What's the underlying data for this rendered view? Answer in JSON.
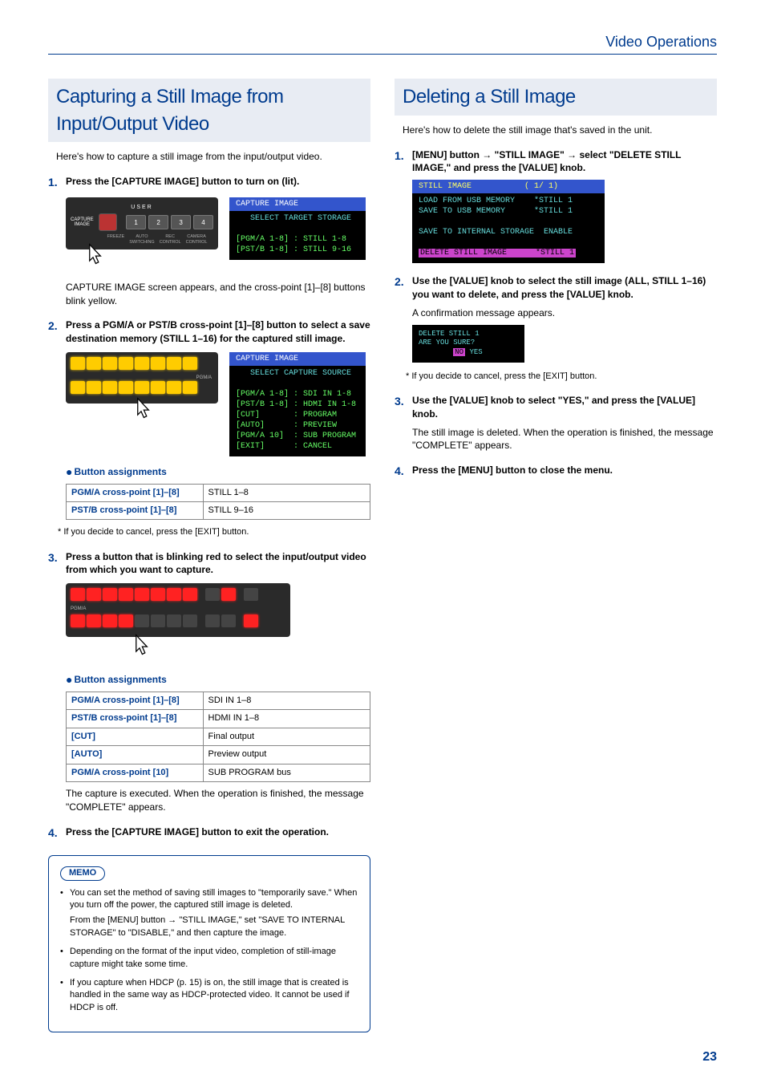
{
  "header": {
    "section": "Video Operations"
  },
  "pageNumber": "23",
  "left": {
    "title": "Capturing a Still Image from Input/Output Video",
    "intro": "Here's how to capture a still image from the input/output video.",
    "step1": "Press the [CAPTURE IMAGE] button to turn on (lit).",
    "panel1": {
      "userLabel": "USER",
      "capLabel": "CAPTURE\nIMAGE",
      "b1": "1",
      "b2": "2",
      "b3": "3",
      "b4": "4",
      "sub1": "FREEZE",
      "sub2": "AUTO\nSWITCHING",
      "sub3": "REC\nCONTROL",
      "sub4": "CAMERA\nCONTROL"
    },
    "screen1": {
      "title": "CAPTURE IMAGE",
      "sub": "SELECT TARGET STORAGE",
      "l1": "[PGM/A 1-8] : STILL 1-8",
      "l2": "[PST/B 1-8] : STILL 9-16"
    },
    "step1note": "CAPTURE IMAGE screen appears, and the cross-point [1]–[8] buttons blink yellow.",
    "step2": "Press a PGM/A or PST/B cross-point [1]–[8] button to select a save destination memory (STILL 1–16) for the captured still image.",
    "screen2": {
      "title": "CAPTURE IMAGE",
      "sub": "SELECT CAPTURE SOURCE",
      "l1": "[PGM/A 1-8] : SDI IN 1-8",
      "l2": "[PST/B 1-8] : HDMI IN 1-8",
      "l3": "[CUT]       : PROGRAM",
      "l4": "[AUTO]      : PREVIEW",
      "l5": "[PGM/A 10]  : SUB PROGRAM",
      "l6": "[EXIT]      : CANCEL"
    },
    "assignTitle": "Button assignments",
    "t1r1a": "PGM/A cross-point [1]–[8]",
    "t1r1b": "STILL 1–8",
    "t1r2a": "PST/B cross-point [1]–[8]",
    "t1r2b": "STILL 9–16",
    "cancelNote": "If you decide to cancel, press the [EXIT] button.",
    "step3": "Press a button that is blinking red to select the input/output video from which you want to capture.",
    "t2r1a": "PGM/A cross-point [1]–[8]",
    "t2r1b": "SDI IN 1–8",
    "t2r2a": "PST/B cross-point [1]–[8]",
    "t2r2b": "HDMI IN 1–8",
    "t2r3a": "[CUT]",
    "t2r3b": "Final output",
    "t2r4a": "[AUTO]",
    "t2r4b": "Preview output",
    "t2r5a": "PGM/A cross-point [10]",
    "t2r5b": "SUB PROGRAM bus",
    "step3note": "The capture is executed. When the operation is finished, the message \"COMPLETE\" appears.",
    "step4": "Press the [CAPTURE IMAGE] button to exit the operation.",
    "memoLabel": "MEMO",
    "memo1": "You can set the method of saving still images to \"temporarily save.\" When you turn off the power, the captured still image is deleted.",
    "memo1sub": "From the [MENU] button → \"STILL IMAGE,\" set \"SAVE TO INTERNAL STORAGE\" to \"DISABLE,\" and then capture the image.",
    "memo2": "Depending on the format of the input video, completion of still-image capture might take some time.",
    "memo3": "If you capture when HDCP (p. 15) is on, the still image that is created is handled in the same way as HDCP-protected video. It cannot be used if HDCP is off."
  },
  "right": {
    "title": "Deleting a Still Image",
    "intro": "Here's how to delete the still image that's saved in the unit.",
    "step1": "[MENU] button → \"STILL IMAGE\" → select \"DELETE STILL IMAGE,\" and press the [VALUE] knob.",
    "screen1": {
      "title": "STILL IMAGE           ( 1/ 1)",
      "l1": "LOAD FROM USB MEMORY    *STILL 1",
      "l2": "SAVE TO USB MEMORY      *STILL 1",
      "l3": "SAVE TO INTERNAL STORAGE  ENABLE",
      "l4": "DELETE STILL IMAGE      *STILL 1"
    },
    "step2": "Use the [VALUE] knob to select the still image (ALL, STILL 1–16) you want to delete, and press the [VALUE] knob.",
    "step2note": "A confirmation message appears.",
    "screen2": {
      "l1": "DELETE STILL 1",
      "l2": "ARE YOU SURE?",
      "no": "NO",
      "yes": "YES"
    },
    "cancelNote": "If you decide to cancel, press the [EXIT] button.",
    "step3": "Use the [VALUE] knob to select \"YES,\" and press the [VALUE] knob.",
    "step3note": "The still image is deleted. When the operation is finished, the message \"COMPLETE\" appears.",
    "step4": "Press the [MENU] button to close the menu."
  }
}
